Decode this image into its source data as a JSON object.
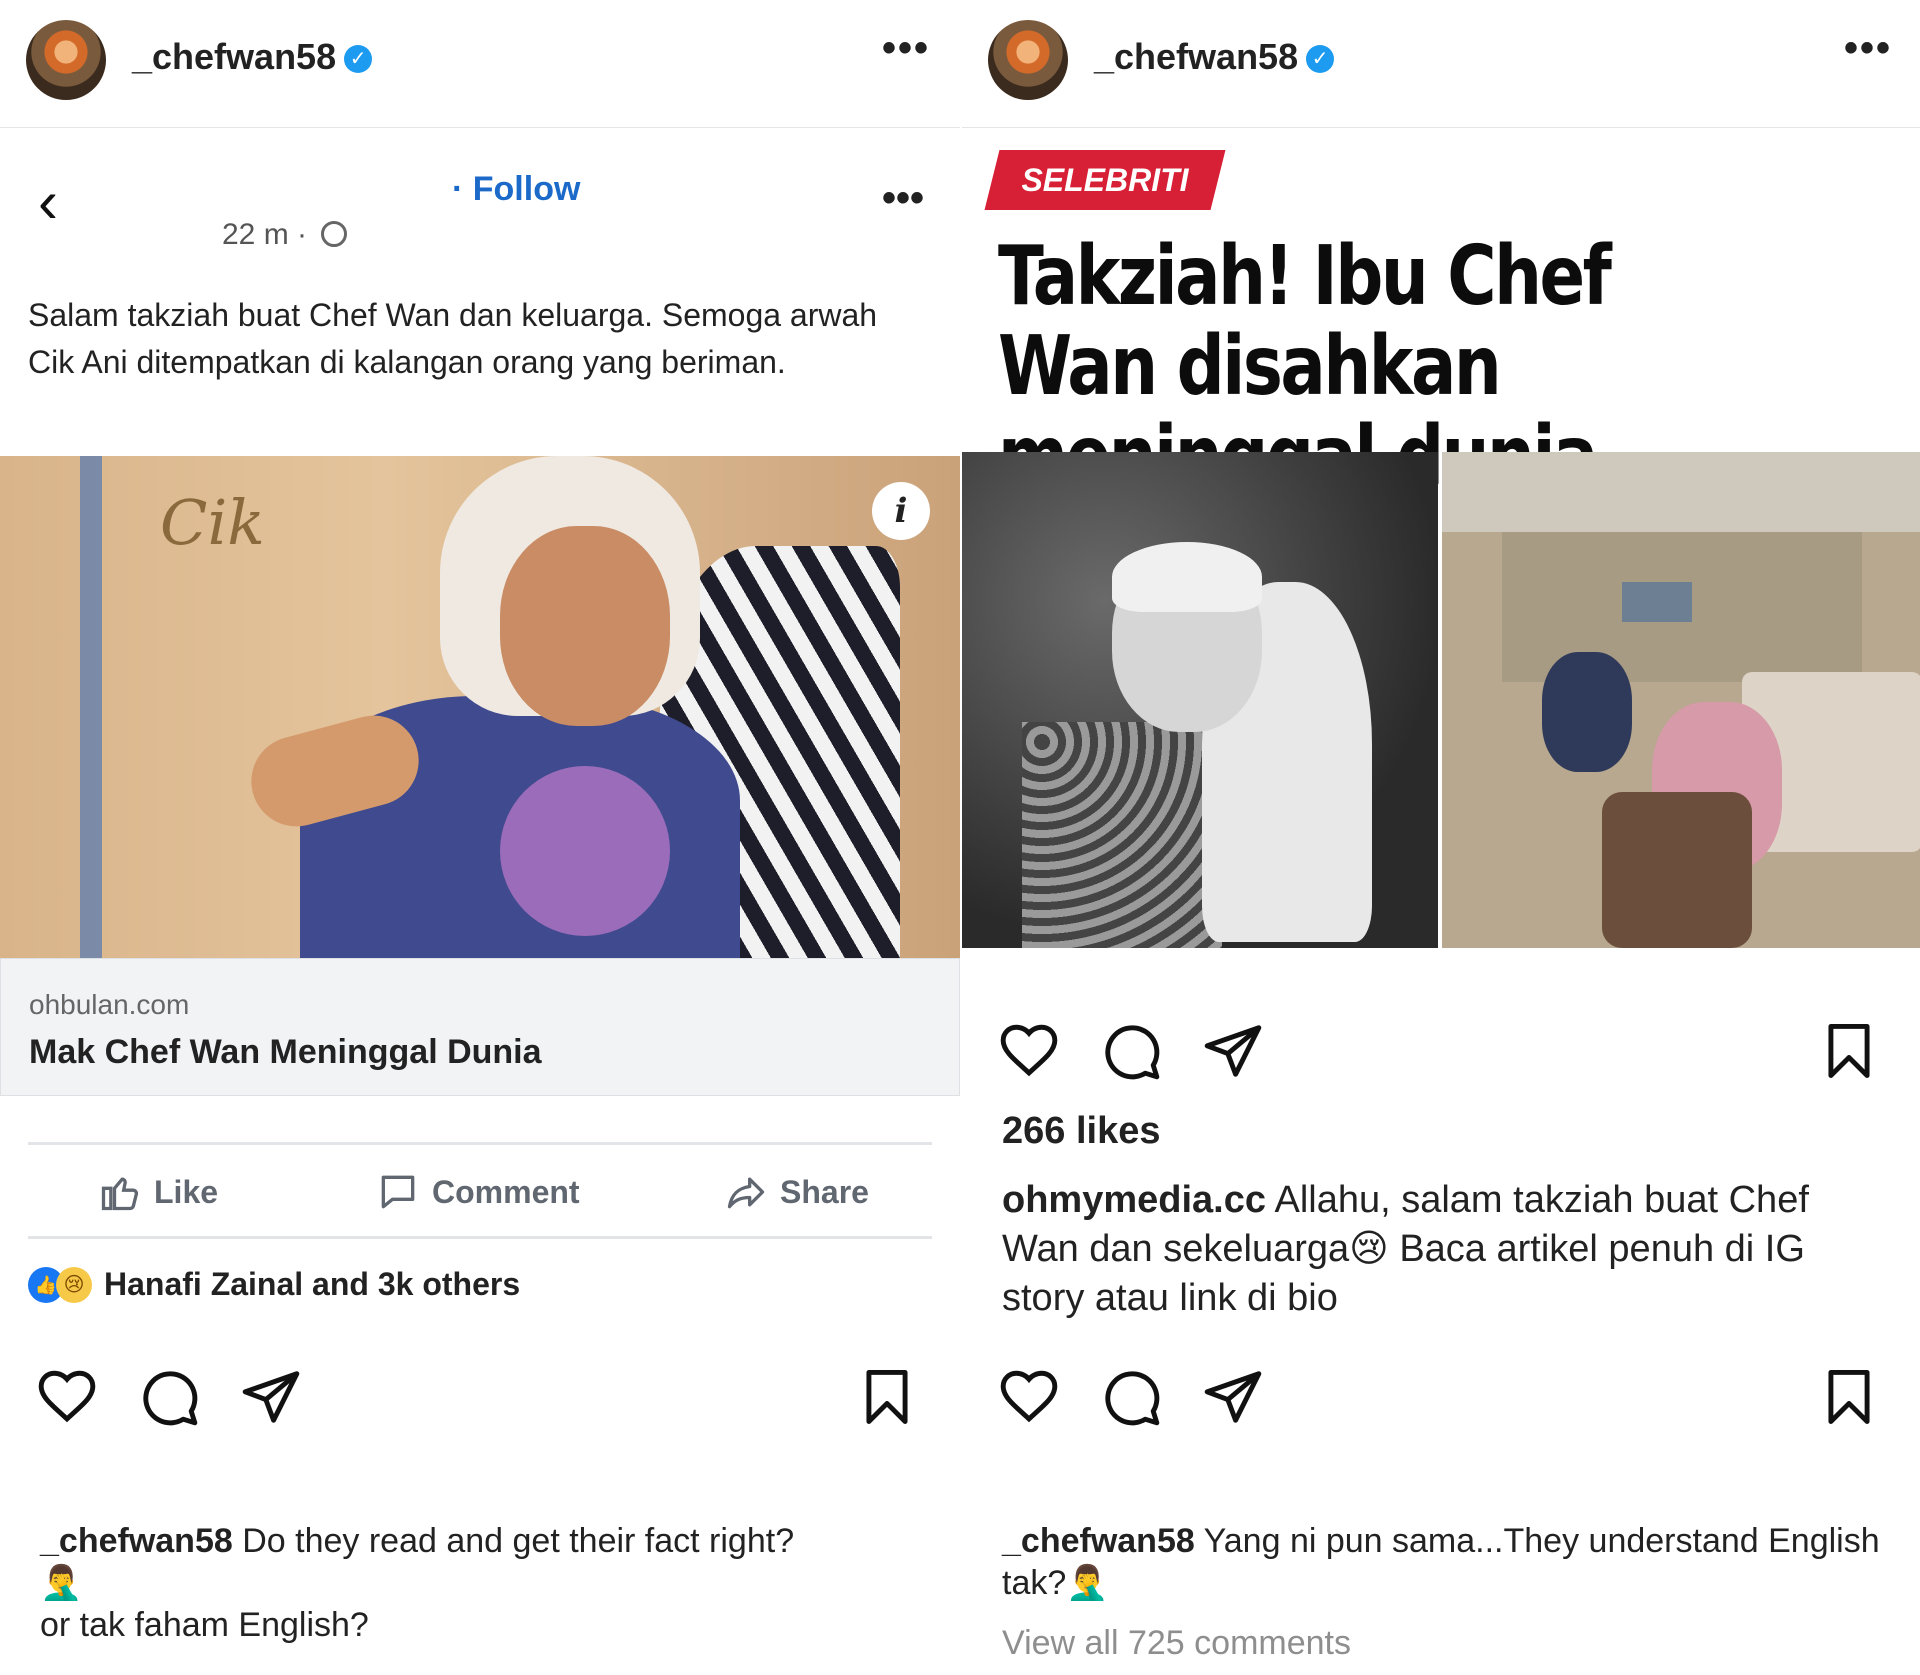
{
  "left": {
    "header": {
      "username": "_chefwan58"
    },
    "fb_post": {
      "follow": "· Follow",
      "time": "22 m ·",
      "text": "Salam takziah buat Chef Wan dan keluarga. Semoga arwah Cik Ani ditempatkan di kalangan orang yang beriman.",
      "image_watermark": "Cik",
      "link_domain": "ohbulan.com",
      "link_title": "Mak Chef Wan Meninggal Dunia",
      "actions": {
        "like": "Like",
        "comment": "Comment",
        "share": "Share"
      },
      "reactions": "Hanafi Zainal and 3k others"
    },
    "caption": {
      "username": "_chefwan58",
      "text": "Do they read and get their fact right?",
      "emoji": "🤦‍♂️",
      "text2": "or tak faham English?"
    }
  },
  "right": {
    "header": {
      "username": "_chefwan58"
    },
    "news": {
      "tag": "SELEBRITI",
      "headline": "Takziah! Ibu Chef Wan disahkan meninggal dunia"
    },
    "likes": "266 likes",
    "post_caption": {
      "username": "ohmymedia.cc",
      "text": "Allahu, salam takziah buat Chef Wan dan sekeluarga",
      "emoji": "😢",
      "text2": "Baca artikel penuh di IG story atau link di bio"
    },
    "caption": {
      "username": "_chefwan58",
      "text": "Yang ni pun sama...They understand English tak?",
      "emoji": "🤦‍♂️"
    },
    "view_all": "View all 725 comments"
  },
  "icons": {
    "verified": "verified-badge-icon",
    "more": "more-dots-icon",
    "back": "chevron-left-icon",
    "globe": "globe-icon",
    "info": "info-icon",
    "heart": "heart-icon",
    "comment": "comment-bubble-icon",
    "send": "send-icon",
    "bookmark": "bookmark-icon"
  },
  "colors": {
    "verified": "#1d9bf0",
    "fb_link": "#1b6ac9",
    "tag": "#d71f35",
    "fb_like": "#1877f2"
  }
}
